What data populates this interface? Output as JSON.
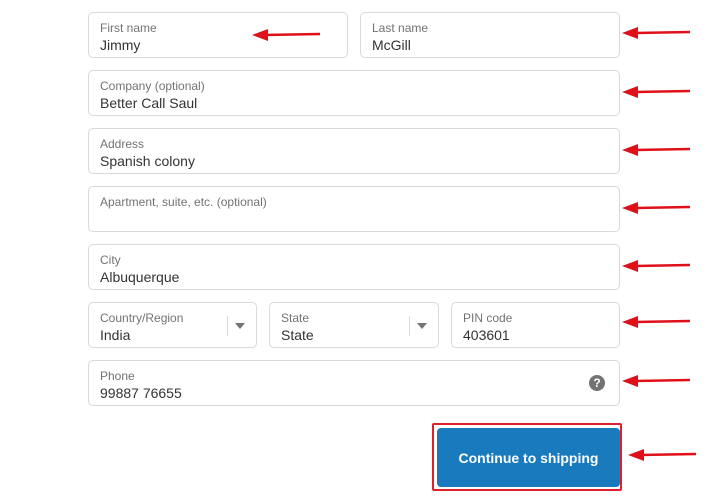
{
  "form": {
    "first_name": {
      "label": "First name",
      "value": "Jimmy"
    },
    "last_name": {
      "label": "Last name",
      "value": "McGill"
    },
    "company": {
      "label": "Company (optional)",
      "value": "Better Call Saul"
    },
    "address": {
      "label": "Address",
      "value": "Spanish colony"
    },
    "apartment": {
      "label": "Apartment, suite, etc. (optional)",
      "value": ""
    },
    "city": {
      "label": "City",
      "value": "Albuquerque"
    },
    "country": {
      "label": "Country/Region",
      "value": "India"
    },
    "state": {
      "label": "State",
      "value": "State"
    },
    "pin": {
      "label": "PIN code",
      "value": "403601"
    },
    "phone": {
      "label": "Phone",
      "value": "99887 76655",
      "help_symbol": "?"
    }
  },
  "actions": {
    "continue_label": "Continue to shipping"
  },
  "annotation": {
    "arrow_color": "#e0101a"
  },
  "theme": {
    "button_color": "#197bbd",
    "border_color": "#d9d9d9"
  }
}
